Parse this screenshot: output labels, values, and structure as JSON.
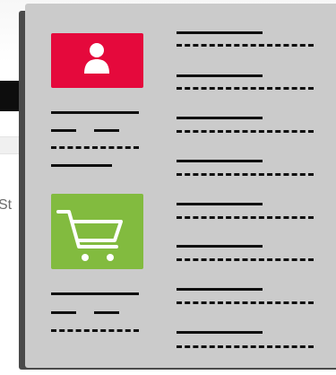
{
  "background": {
    "partial_text": "St"
  },
  "illustration": {
    "tiles": [
      {
        "icon": "user-icon",
        "color": "#e5093c"
      },
      {
        "icon": "shopping-cart-icon",
        "color": "#82bb3f"
      }
    ],
    "line_color": "#0f0f0f",
    "paper_color": "#cbcbcb"
  }
}
